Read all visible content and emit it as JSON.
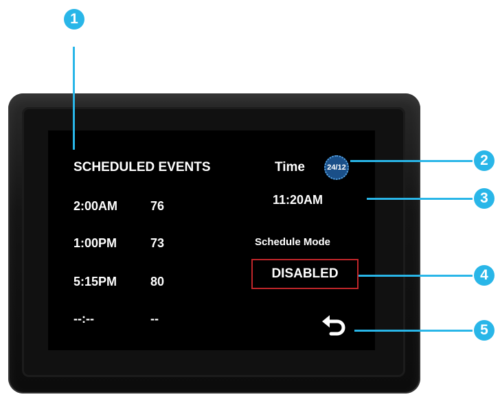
{
  "schedule": {
    "title": "SCHEDULED EVENTS",
    "events": [
      {
        "time": "2:00AM",
        "temp": "76"
      },
      {
        "time": "1:00PM",
        "temp": "73"
      },
      {
        "time": "5:15PM",
        "temp": "80"
      },
      {
        "time": "--:--",
        "temp": "--"
      }
    ]
  },
  "time_panel": {
    "label": "Time",
    "format_icon_text": "24/12",
    "format_icon": "clock-format-toggle-icon",
    "current_time": "11:20AM"
  },
  "mode": {
    "label": "Schedule Mode",
    "status": "DISABLED",
    "status_border_color": "#c0262a"
  },
  "back_icon": "back-arrow-icon",
  "callouts": [
    "1",
    "2",
    "3",
    "4",
    "5"
  ],
  "colors": {
    "callout": "#29b6e8",
    "screen": "#000000"
  }
}
